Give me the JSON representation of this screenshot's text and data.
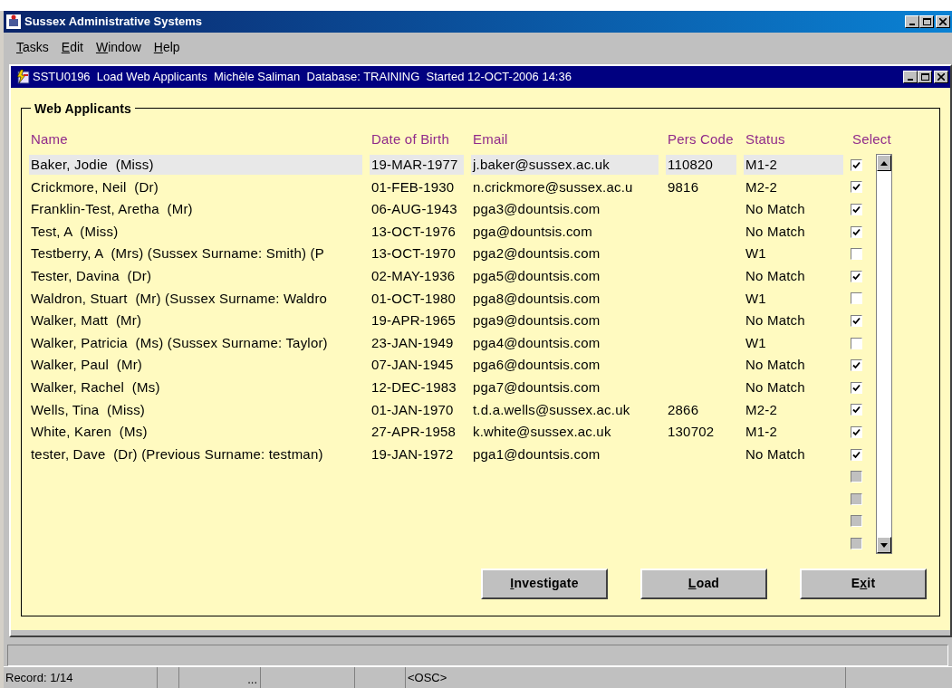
{
  "window": {
    "title": "Sussex Administrative Systems"
  },
  "menu": [
    {
      "label": "Tasks"
    },
    {
      "label": "Edit"
    },
    {
      "label": "Window"
    },
    {
      "label": "Help"
    }
  ],
  "form_window": {
    "title": "SSTU0196  Load Web Applicants  Michèle Saliman  Database: TRAINING  Started 12-OCT-2006 14:36"
  },
  "group": {
    "title": "Web Applicants"
  },
  "columns": [
    "Name",
    "Date of Birth",
    "Email",
    "Pers Code",
    "Status",
    "Select"
  ],
  "rows": [
    {
      "name": "Baker, Jodie  (Miss)",
      "dob": "19-MAR-1977",
      "email": "j.baker@sussex.ac.uk",
      "pers_code": "110820",
      "status": "M1-2",
      "checked": true,
      "selected": true
    },
    {
      "name": "Crickmore, Neil  (Dr)",
      "dob": "01-FEB-1930",
      "email": "n.crickmore@sussex.ac.u",
      "pers_code": "9816",
      "status": "M2-2",
      "checked": true,
      "selected": false
    },
    {
      "name": "Franklin-Test, Aretha  (Mr)",
      "dob": "06-AUG-1943",
      "email": "pga3@dountsis.com",
      "status": "No Match",
      "checked": true,
      "selected": false
    },
    {
      "name": "Test, A  (Miss)",
      "dob": "13-OCT-1976",
      "email": "pga@dountsis.com",
      "status": "No Match",
      "checked": true,
      "selected": false
    },
    {
      "name": "Testberry, A  (Mrs) (Sussex Surname: Smith) (P",
      "dob": "13-OCT-1970",
      "email": "pga2@dountsis.com",
      "status": "W1",
      "checked": false,
      "selected": false
    },
    {
      "name": "Tester, Davina  (Dr)",
      "dob": "02-MAY-1936",
      "email": "pga5@dountsis.com",
      "status": "No Match",
      "checked": true,
      "selected": false
    },
    {
      "name": "Waldron, Stuart  (Mr) (Sussex Surname: Waldro",
      "dob": "01-OCT-1980",
      "email": "pga8@dountsis.com",
      "status": "W1",
      "checked": false,
      "selected": false
    },
    {
      "name": "Walker, Matt  (Mr)",
      "dob": "19-APR-1965",
      "email": "pga9@dountsis.com",
      "status": "No Match",
      "checked": true,
      "selected": false
    },
    {
      "name": "Walker, Patricia  (Ms) (Sussex Surname: Taylor)",
      "dob": "23-JAN-1949",
      "email": "pga4@dountsis.com",
      "status": "W1",
      "checked": false,
      "selected": false
    },
    {
      "name": "Walker, Paul  (Mr)",
      "dob": "07-JAN-1945",
      "email": "pga6@dountsis.com",
      "status": "No Match",
      "checked": true,
      "selected": false
    },
    {
      "name": "Walker, Rachel  (Ms)",
      "dob": "12-DEC-1983",
      "email": "pga7@dountsis.com",
      "status": "No Match",
      "checked": true,
      "selected": false
    },
    {
      "name": "Wells, Tina  (Miss)",
      "dob": "01-JAN-1970",
      "email": "t.d.a.wells@sussex.ac.uk",
      "pers_code": "2866",
      "status": "M2-2",
      "checked": true,
      "selected": false
    },
    {
      "name": "White, Karen  (Ms)",
      "dob": "27-APR-1958",
      "email": "k.white@sussex.ac.uk",
      "pers_code": "130702",
      "status": "M1-2",
      "checked": true,
      "selected": false
    },
    {
      "name": "tester, Dave  (Dr) (Previous Surname: testman)",
      "dob": "19-JAN-1972",
      "email": "pga1@dountsis.com",
      "status": "No Match",
      "checked": true,
      "selected": false
    }
  ],
  "empty_rows": [
    {
      "disabled": true
    },
    {
      "disabled": true
    },
    {
      "disabled": true
    },
    {
      "disabled": true
    }
  ],
  "buttons": [
    {
      "label": "Investigate"
    },
    {
      "label": "Load"
    },
    {
      "label": "Exit"
    }
  ],
  "status_bar": {
    "record": "Record: 1/14",
    "cell_3": "...",
    "cell_6": "<OSC>"
  }
}
